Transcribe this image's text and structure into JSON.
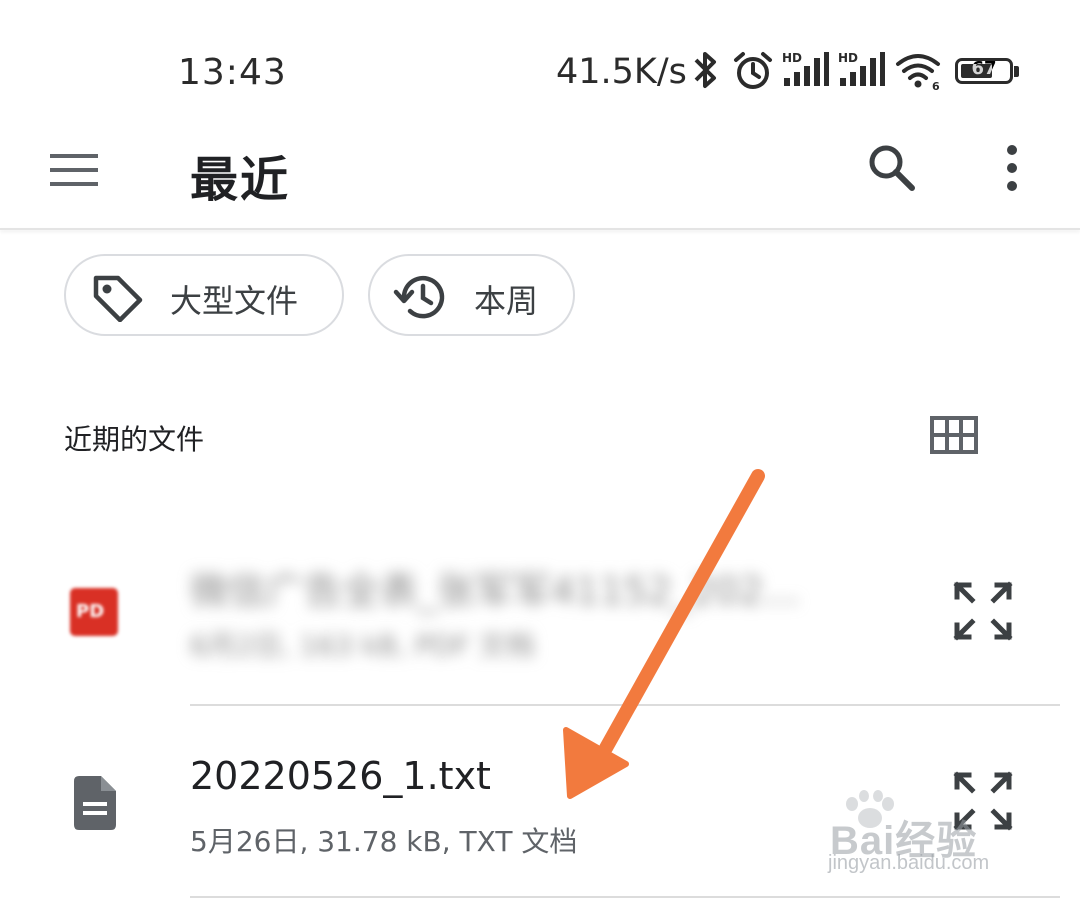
{
  "status_bar": {
    "time": "13:43",
    "net_speed": "41.5K/s",
    "battery": "67",
    "battery_level": 0.67,
    "icons": [
      "bluetooth-icon",
      "alarm-icon",
      "hd-signal-icon",
      "hd-signal-icon",
      "wifi-icon",
      "battery-icon"
    ]
  },
  "app_bar": {
    "title": "最近",
    "icons": [
      "menu-icon",
      "search-icon",
      "more-vert-icon"
    ]
  },
  "chips": [
    {
      "label": "大型文件",
      "icon": "tag-icon"
    },
    {
      "label": "本周",
      "icon": "history-icon"
    }
  ],
  "section": {
    "title": "近期的文件",
    "icon": "grid-view-icon"
  },
  "files": [
    {
      "name": "微信广告全表_张军军41152_202...",
      "meta": "6月2日, 163 kB, PDF 文档",
      "icon": "pdf-icon",
      "icon_text": "PD",
      "blurred": true
    },
    {
      "name": "20220526_1.txt",
      "meta": "5月26日, 31.78 kB, TXT 文档",
      "icon": "document-icon"
    }
  ],
  "watermark": {
    "brand": "Bai经验",
    "url": "jingyan.baidu.com"
  },
  "colors": {
    "accent_arrow": "#F27A3E",
    "pdf_red": "#D93025",
    "icon_gray": "#5f6368"
  }
}
